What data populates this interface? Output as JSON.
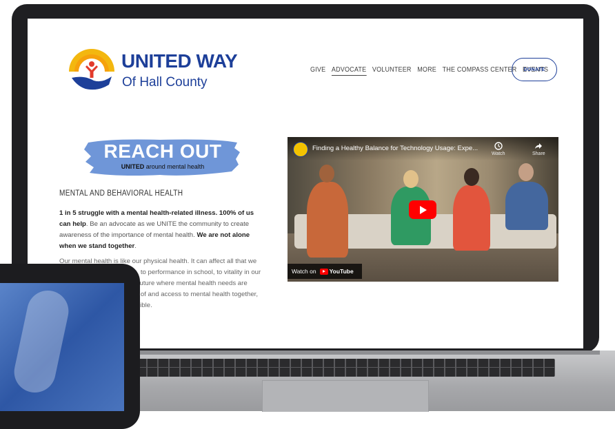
{
  "brand": {
    "name": "UNITED WAY",
    "subname": "Of Hall County",
    "color": "#1d3f99"
  },
  "nav": {
    "items": [
      "GIVE",
      "ADVOCATE",
      "VOLUNTEER",
      "MORE",
      "THE COMPASS CENTER",
      "EVENTS"
    ],
    "active": "ADVOCATE",
    "donate_label": "DONATE"
  },
  "banner": {
    "title": "REACH OUT",
    "sub_bold": "UNITED",
    "sub_rest": " around mental health",
    "color": "#6f96d8"
  },
  "content": {
    "heading": "MENTAL AND BEHAVIORAL HEALTH",
    "p1_bold1": "1 in 5 struggle with a mental health-related illness. 100% of us can help",
    "p1_text": ". Be an advocate as we UNITE the community to create awareness of the importance of mental health. ",
    "p1_bold2": "We are not alone when we stand together",
    "p1_end": ".",
    "p2": "Our mental health is like our physical health. It can affect all that we do, from absences at work, to performance in school, to vitality in our community. We envision a future where mental health needs are recognized with knowledge of and access to mental health together, we can change what’s possible."
  },
  "video": {
    "title": "Finding a Healthy Balance for Technology Usage: Expe...",
    "watch_later": "Watch",
    "share": "Share",
    "watch_on": "Watch on",
    "youtube": "YouTube"
  }
}
